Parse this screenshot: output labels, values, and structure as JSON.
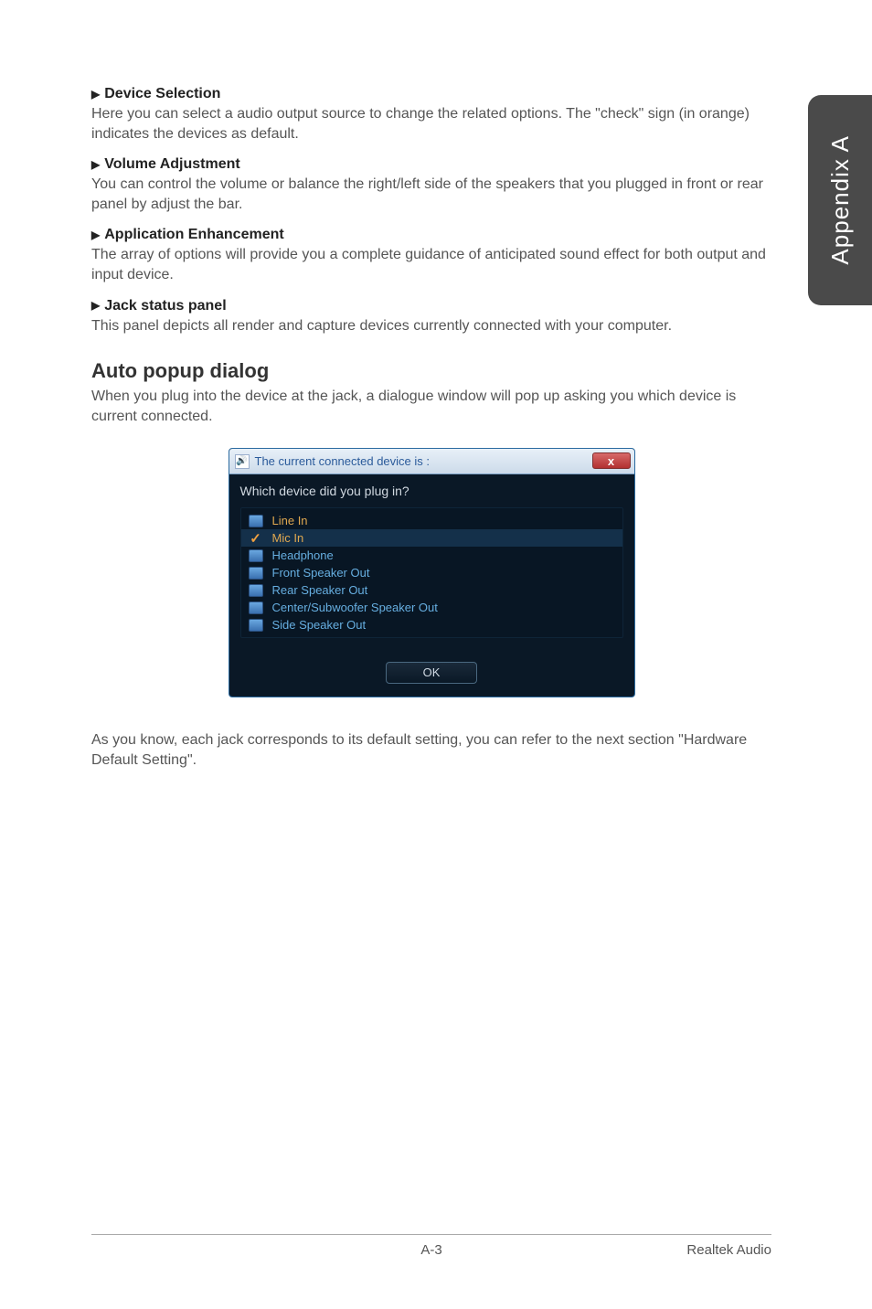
{
  "side_tab": "Appendix A",
  "sections": {
    "device_selection": {
      "title": "Device Selection",
      "body": "Here you can select a audio output source to change the related options. The \"check\" sign (in orange) indicates the devices as default."
    },
    "volume_adjustment": {
      "title": "Volume Adjustment",
      "body": "You can control the volume or balance the right/left side of the speakers that you plugged in front or rear panel by adjust the bar."
    },
    "application_enhancement": {
      "title": "Application Enhancement",
      "body": "The array of options will provide you a complete guidance of anticipated sound effect for both output and input device."
    },
    "jack_status": {
      "title": "Jack status panel",
      "body": "This panel depicts all render and capture devices currently connected with your computer."
    }
  },
  "auto_popup": {
    "heading": "Auto popup dialog",
    "body": "When you plug into the device at the jack, a dialogue window will pop up asking you which device is current connected."
  },
  "dialog": {
    "title": "The current connected device is :",
    "prompt": "Which device did you plug in?",
    "close": "x",
    "items": [
      {
        "label": "Line In",
        "selected": false,
        "icon": "square"
      },
      {
        "label": "Mic In",
        "selected": true,
        "icon": "check"
      },
      {
        "label": "Headphone",
        "selected": false,
        "icon": "square"
      },
      {
        "label": "Front Speaker Out",
        "selected": false,
        "icon": "square"
      },
      {
        "label": "Rear Speaker Out",
        "selected": false,
        "icon": "square"
      },
      {
        "label": "Center/Subwoofer Speaker Out",
        "selected": false,
        "icon": "square"
      },
      {
        "label": "Side Speaker Out",
        "selected": false,
        "icon": "square"
      }
    ],
    "ok": "OK"
  },
  "after_dialog": "As you know, each jack corresponds to its default setting, you can refer to the next section \"Hardware Default Setting\".",
  "footer": {
    "page": "A-3",
    "right": "Realtek Audio"
  }
}
